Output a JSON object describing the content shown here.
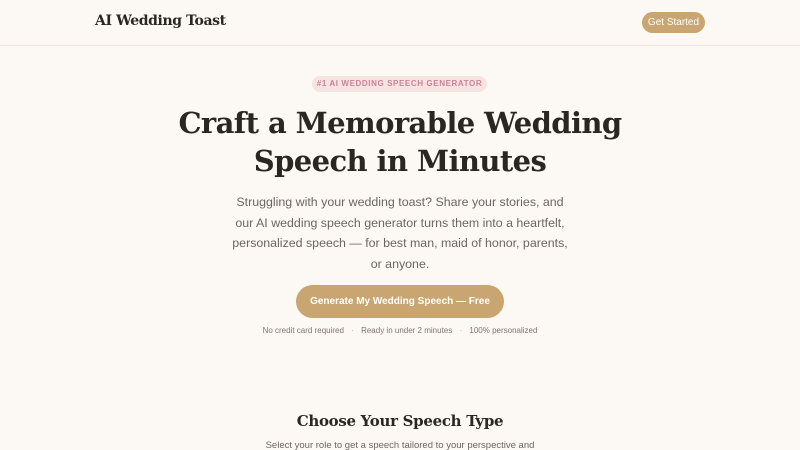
{
  "header": {
    "logo": "AI Wedding Toast",
    "cta_label": "Get Started"
  },
  "hero": {
    "badge": "#1 AI WEDDING SPEECH GENERATOR",
    "title_line1": "Craft a Memorable Wedding",
    "title_line2": "Speech in Minutes",
    "subtitle": "Struggling with your wedding toast? Share your stories, and our AI wedding speech generator turns them into a heartfelt, personalized speech — for best man, maid of honor, parents, or anyone.",
    "cta_label": "Generate My Wedding Speech — Free",
    "perks": [
      "No credit card required",
      "Ready in under 2 minutes",
      "100% personalized"
    ],
    "perk_separator": "·"
  },
  "speech_types": {
    "title": "Choose Your Speech Type",
    "subtitle": "Select your role to get a speech tailored to your perspective and"
  },
  "colors": {
    "background": "#fcf8f4",
    "accent": "#c9a671",
    "badge_bg": "#f7e3df",
    "badge_text": "#c7849a",
    "heading": "#2a2622",
    "body_text": "#6b6660"
  }
}
